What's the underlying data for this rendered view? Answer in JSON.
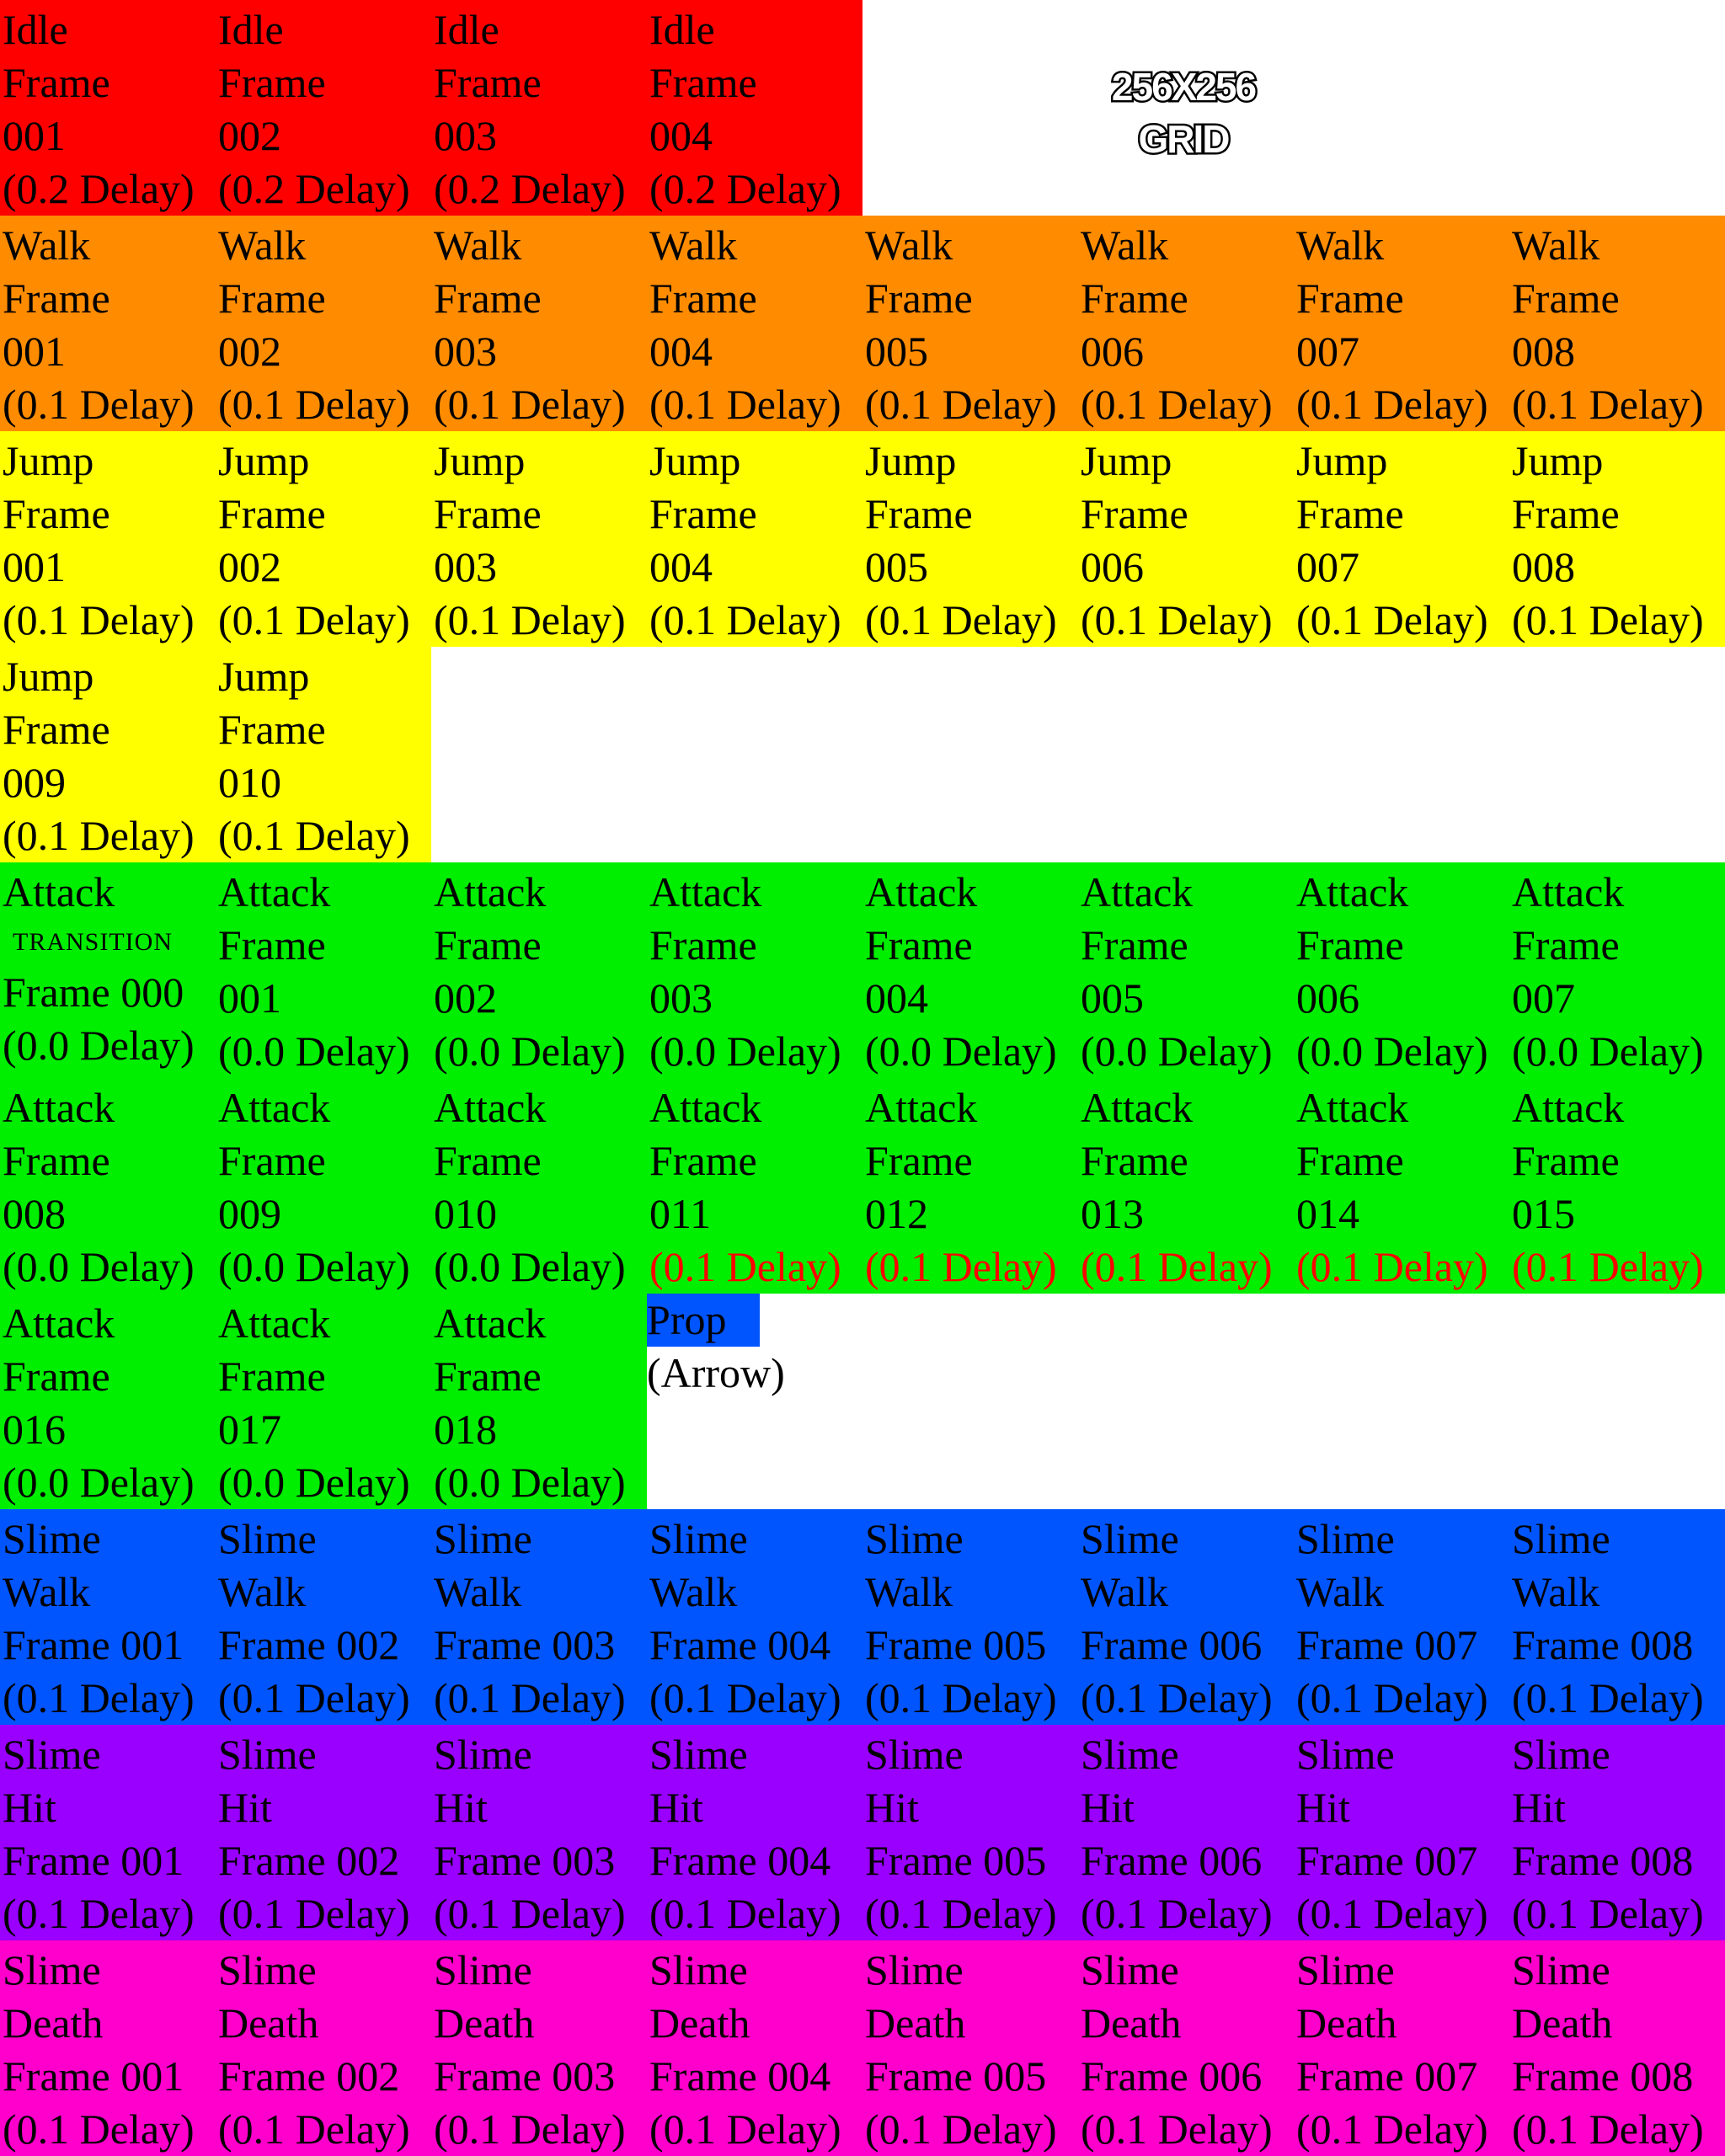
{
  "colors": {
    "idle": "#ff0000",
    "walk": "#ff8c00",
    "jump": "#ffff00",
    "attack": "#00ee00",
    "prop": "#0055ff",
    "slime_walk": "#0055ff",
    "slime_hit": "#9900ff",
    "slime_death": "#ff00cc",
    "background": "#ffffff",
    "highlight_text": "#ff0000"
  },
  "grid_label": "256X256\nGRID",
  "cells": [
    {
      "row": 0,
      "col": 0,
      "fill": "idle",
      "lines": [
        "Idle",
        "Frame",
        "001",
        "(0.2 Delay)"
      ]
    },
    {
      "row": 0,
      "col": 1,
      "fill": "idle",
      "lines": [
        "Idle",
        "Frame",
        "002",
        "(0.2 Delay)"
      ]
    },
    {
      "row": 0,
      "col": 2,
      "fill": "idle",
      "lines": [
        "Idle",
        "Frame",
        "003",
        "(0.2 Delay)"
      ]
    },
    {
      "row": 0,
      "col": 3,
      "fill": "idle",
      "lines": [
        "Idle",
        "Frame",
        "004",
        "(0.2 Delay)"
      ]
    },
    {
      "row": 1,
      "col": 0,
      "fill": "walk",
      "lines": [
        "Walk",
        "Frame",
        "001",
        "(0.1 Delay)"
      ]
    },
    {
      "row": 1,
      "col": 1,
      "fill": "walk",
      "lines": [
        "Walk",
        "Frame",
        "002",
        "(0.1 Delay)"
      ]
    },
    {
      "row": 1,
      "col": 2,
      "fill": "walk",
      "lines": [
        "Walk",
        "Frame",
        "003",
        "(0.1 Delay)"
      ]
    },
    {
      "row": 1,
      "col": 3,
      "fill": "walk",
      "lines": [
        "Walk",
        "Frame",
        "004",
        "(0.1 Delay)"
      ]
    },
    {
      "row": 1,
      "col": 4,
      "fill": "walk",
      "lines": [
        "Walk",
        "Frame",
        "005",
        "(0.1 Delay)"
      ]
    },
    {
      "row": 1,
      "col": 5,
      "fill": "walk",
      "lines": [
        "Walk",
        "Frame",
        "006",
        "(0.1 Delay)"
      ]
    },
    {
      "row": 1,
      "col": 6,
      "fill": "walk",
      "lines": [
        "Walk",
        "Frame",
        "007",
        "(0.1 Delay)"
      ]
    },
    {
      "row": 1,
      "col": 7,
      "fill": "walk",
      "lines": [
        "Walk",
        "Frame",
        "008",
        "(0.1 Delay)"
      ]
    },
    {
      "row": 2,
      "col": 0,
      "fill": "jump",
      "lines": [
        "Jump",
        "Frame",
        "001",
        "(0.1 Delay)"
      ]
    },
    {
      "row": 2,
      "col": 1,
      "fill": "jump",
      "lines": [
        "Jump",
        "Frame",
        "002",
        "(0.1 Delay)"
      ]
    },
    {
      "row": 2,
      "col": 2,
      "fill": "jump",
      "lines": [
        "Jump",
        "Frame",
        "003",
        "(0.1 Delay)"
      ]
    },
    {
      "row": 2,
      "col": 3,
      "fill": "jump",
      "lines": [
        "Jump",
        "Frame",
        "004",
        "(0.1 Delay)"
      ]
    },
    {
      "row": 2,
      "col": 4,
      "fill": "jump",
      "lines": [
        "Jump",
        "Frame",
        "005",
        "(0.1 Delay)"
      ]
    },
    {
      "row": 2,
      "col": 5,
      "fill": "jump",
      "lines": [
        "Jump",
        "Frame",
        "006",
        "(0.1 Delay)"
      ]
    },
    {
      "row": 2,
      "col": 6,
      "fill": "jump",
      "lines": [
        "Jump",
        "Frame",
        "007",
        "(0.1 Delay)"
      ]
    },
    {
      "row": 2,
      "col": 7,
      "fill": "jump",
      "lines": [
        "Jump",
        "Frame",
        "008",
        "(0.1 Delay)"
      ]
    },
    {
      "row": 3,
      "col": 0,
      "fill": "jump",
      "lines": [
        "Jump",
        "Frame",
        "009",
        "(0.1 Delay)"
      ]
    },
    {
      "row": 3,
      "col": 1,
      "fill": "jump",
      "lines": [
        "Jump",
        "Frame",
        "010",
        "(0.1 Delay)"
      ]
    },
    {
      "row": 4,
      "col": 0,
      "fill": "attack",
      "lines": [
        "Attack",
        "TRANSITION",
        "Frame 000",
        "(0.0 Delay)"
      ],
      "small_line": 1
    },
    {
      "row": 4,
      "col": 1,
      "fill": "attack",
      "lines": [
        "Attack",
        "Frame",
        "001",
        "(0.0 Delay)"
      ]
    },
    {
      "row": 4,
      "col": 2,
      "fill": "attack",
      "lines": [
        "Attack",
        "Frame",
        "002",
        "(0.0 Delay)"
      ]
    },
    {
      "row": 4,
      "col": 3,
      "fill": "attack",
      "lines": [
        "Attack",
        "Frame",
        "003",
        "(0.0 Delay)"
      ]
    },
    {
      "row": 4,
      "col": 4,
      "fill": "attack",
      "lines": [
        "Attack",
        "Frame",
        "004",
        "(0.0 Delay)"
      ]
    },
    {
      "row": 4,
      "col": 5,
      "fill": "attack",
      "lines": [
        "Attack",
        "Frame",
        "005",
        "(0.0 Delay)"
      ]
    },
    {
      "row": 4,
      "col": 6,
      "fill": "attack",
      "lines": [
        "Attack",
        "Frame",
        "006",
        "(0.0 Delay)"
      ]
    },
    {
      "row": 4,
      "col": 7,
      "fill": "attack",
      "lines": [
        "Attack",
        "Frame",
        "007",
        "(0.0 Delay)"
      ]
    },
    {
      "row": 5,
      "col": 0,
      "fill": "attack",
      "lines": [
        "Attack",
        "Frame",
        "008",
        "(0.0 Delay)"
      ]
    },
    {
      "row": 5,
      "col": 1,
      "fill": "attack",
      "lines": [
        "Attack",
        "Frame",
        "009",
        "(0.0 Delay)"
      ]
    },
    {
      "row": 5,
      "col": 2,
      "fill": "attack",
      "lines": [
        "Attack",
        "Frame",
        "010",
        "(0.0 Delay)"
      ]
    },
    {
      "row": 5,
      "col": 3,
      "fill": "attack",
      "lines": [
        "Attack",
        "Frame",
        "011",
        "(0.1 Delay)"
      ],
      "red_last": true
    },
    {
      "row": 5,
      "col": 4,
      "fill": "attack",
      "lines": [
        "Attack",
        "Frame",
        "012",
        "(0.1 Delay)"
      ],
      "red_last": true
    },
    {
      "row": 5,
      "col": 5,
      "fill": "attack",
      "lines": [
        "Attack",
        "Frame",
        "013",
        "(0.1 Delay)"
      ],
      "red_last": true
    },
    {
      "row": 5,
      "col": 6,
      "fill": "attack",
      "lines": [
        "Attack",
        "Frame",
        "014",
        "(0.1 Delay)"
      ],
      "red_last": true
    },
    {
      "row": 5,
      "col": 7,
      "fill": "attack",
      "lines": [
        "Attack",
        "Frame",
        "015",
        "(0.1 Delay)"
      ],
      "red_last": true
    },
    {
      "row": 6,
      "col": 0,
      "fill": "attack",
      "lines": [
        "Attack",
        "Frame",
        "016",
        "(0.0 Delay)"
      ]
    },
    {
      "row": 6,
      "col": 1,
      "fill": "attack",
      "lines": [
        "Attack",
        "Frame",
        "017",
        "(0.0 Delay)"
      ]
    },
    {
      "row": 6,
      "col": 2,
      "fill": "attack",
      "lines": [
        "Attack",
        "Frame",
        "018",
        "(0.0 Delay)"
      ]
    },
    {
      "row": 7,
      "col": 0,
      "fill": "slime_walk",
      "lines": [
        "Slime",
        "Walk",
        "Frame 001",
        "(0.1 Delay)"
      ]
    },
    {
      "row": 7,
      "col": 1,
      "fill": "slime_walk",
      "lines": [
        "Slime",
        "Walk",
        "Frame 002",
        "(0.1 Delay)"
      ]
    },
    {
      "row": 7,
      "col": 2,
      "fill": "slime_walk",
      "lines": [
        "Slime",
        "Walk",
        "Frame 003",
        "(0.1 Delay)"
      ]
    },
    {
      "row": 7,
      "col": 3,
      "fill": "slime_walk",
      "lines": [
        "Slime",
        "Walk",
        "Frame 004",
        "(0.1 Delay)"
      ]
    },
    {
      "row": 7,
      "col": 4,
      "fill": "slime_walk",
      "lines": [
        "Slime",
        "Walk",
        "Frame 005",
        "(0.1 Delay)"
      ]
    },
    {
      "row": 7,
      "col": 5,
      "fill": "slime_walk",
      "lines": [
        "Slime",
        "Walk",
        "Frame 006",
        "(0.1 Delay)"
      ]
    },
    {
      "row": 7,
      "col": 6,
      "fill": "slime_walk",
      "lines": [
        "Slime",
        "Walk",
        "Frame 007",
        "(0.1 Delay)"
      ]
    },
    {
      "row": 7,
      "col": 7,
      "fill": "slime_walk",
      "lines": [
        "Slime",
        "Walk",
        "Frame 008",
        "(0.1 Delay)"
      ]
    },
    {
      "row": 8,
      "col": 0,
      "fill": "slime_hit",
      "lines": [
        "Slime",
        "Hit",
        "Frame 001",
        "(0.1 Delay)"
      ]
    },
    {
      "row": 8,
      "col": 1,
      "fill": "slime_hit",
      "lines": [
        "Slime",
        "Hit",
        "Frame 002",
        "(0.1 Delay)"
      ]
    },
    {
      "row": 8,
      "col": 2,
      "fill": "slime_hit",
      "lines": [
        "Slime",
        "Hit",
        "Frame 003",
        "(0.1 Delay)"
      ]
    },
    {
      "row": 8,
      "col": 3,
      "fill": "slime_hit",
      "lines": [
        "Slime",
        "Hit",
        "Frame 004",
        "(0.1 Delay)"
      ]
    },
    {
      "row": 8,
      "col": 4,
      "fill": "slime_hit",
      "lines": [
        "Slime",
        "Hit",
        "Frame 005",
        "(0.1 Delay)"
      ]
    },
    {
      "row": 8,
      "col": 5,
      "fill": "slime_hit",
      "lines": [
        "Slime",
        "Hit",
        "Frame 006",
        "(0.1 Delay)"
      ]
    },
    {
      "row": 8,
      "col": 6,
      "fill": "slime_hit",
      "lines": [
        "Slime",
        "Hit",
        "Frame 007",
        "(0.1 Delay)"
      ]
    },
    {
      "row": 8,
      "col": 7,
      "fill": "slime_hit",
      "lines": [
        "Slime",
        "Hit",
        "Frame 008",
        "(0.1 Delay)"
      ]
    },
    {
      "row": 9,
      "col": 0,
      "fill": "slime_death",
      "lines": [
        "Slime",
        "Death",
        "Frame 001",
        "(0.1 Delay)"
      ]
    },
    {
      "row": 9,
      "col": 1,
      "fill": "slime_death",
      "lines": [
        "Slime",
        "Death",
        "Frame 002",
        "(0.1 Delay)"
      ]
    },
    {
      "row": 9,
      "col": 2,
      "fill": "slime_death",
      "lines": [
        "Slime",
        "Death",
        "Frame 003",
        "(0.1 Delay)"
      ]
    },
    {
      "row": 9,
      "col": 3,
      "fill": "slime_death",
      "lines": [
        "Slime",
        "Death",
        "Frame 004",
        "(0.1 Delay)"
      ]
    },
    {
      "row": 9,
      "col": 4,
      "fill": "slime_death",
      "lines": [
        "Slime",
        "Death",
        "Frame 005",
        "(0.1 Delay)"
      ]
    },
    {
      "row": 9,
      "col": 5,
      "fill": "slime_death",
      "lines": [
        "Slime",
        "Death",
        "Frame 006",
        "(0.1 Delay)"
      ]
    },
    {
      "row": 9,
      "col": 6,
      "fill": "slime_death",
      "lines": [
        "Slime",
        "Death",
        "Frame 007",
        "(0.1 Delay)"
      ]
    },
    {
      "row": 9,
      "col": 7,
      "fill": "slime_death",
      "lines": [
        "Slime",
        "Death",
        "Frame 008",
        "(0.1 Delay)"
      ]
    }
  ],
  "prop": {
    "label": "Prop",
    "sublabel": "(Arrow)"
  }
}
